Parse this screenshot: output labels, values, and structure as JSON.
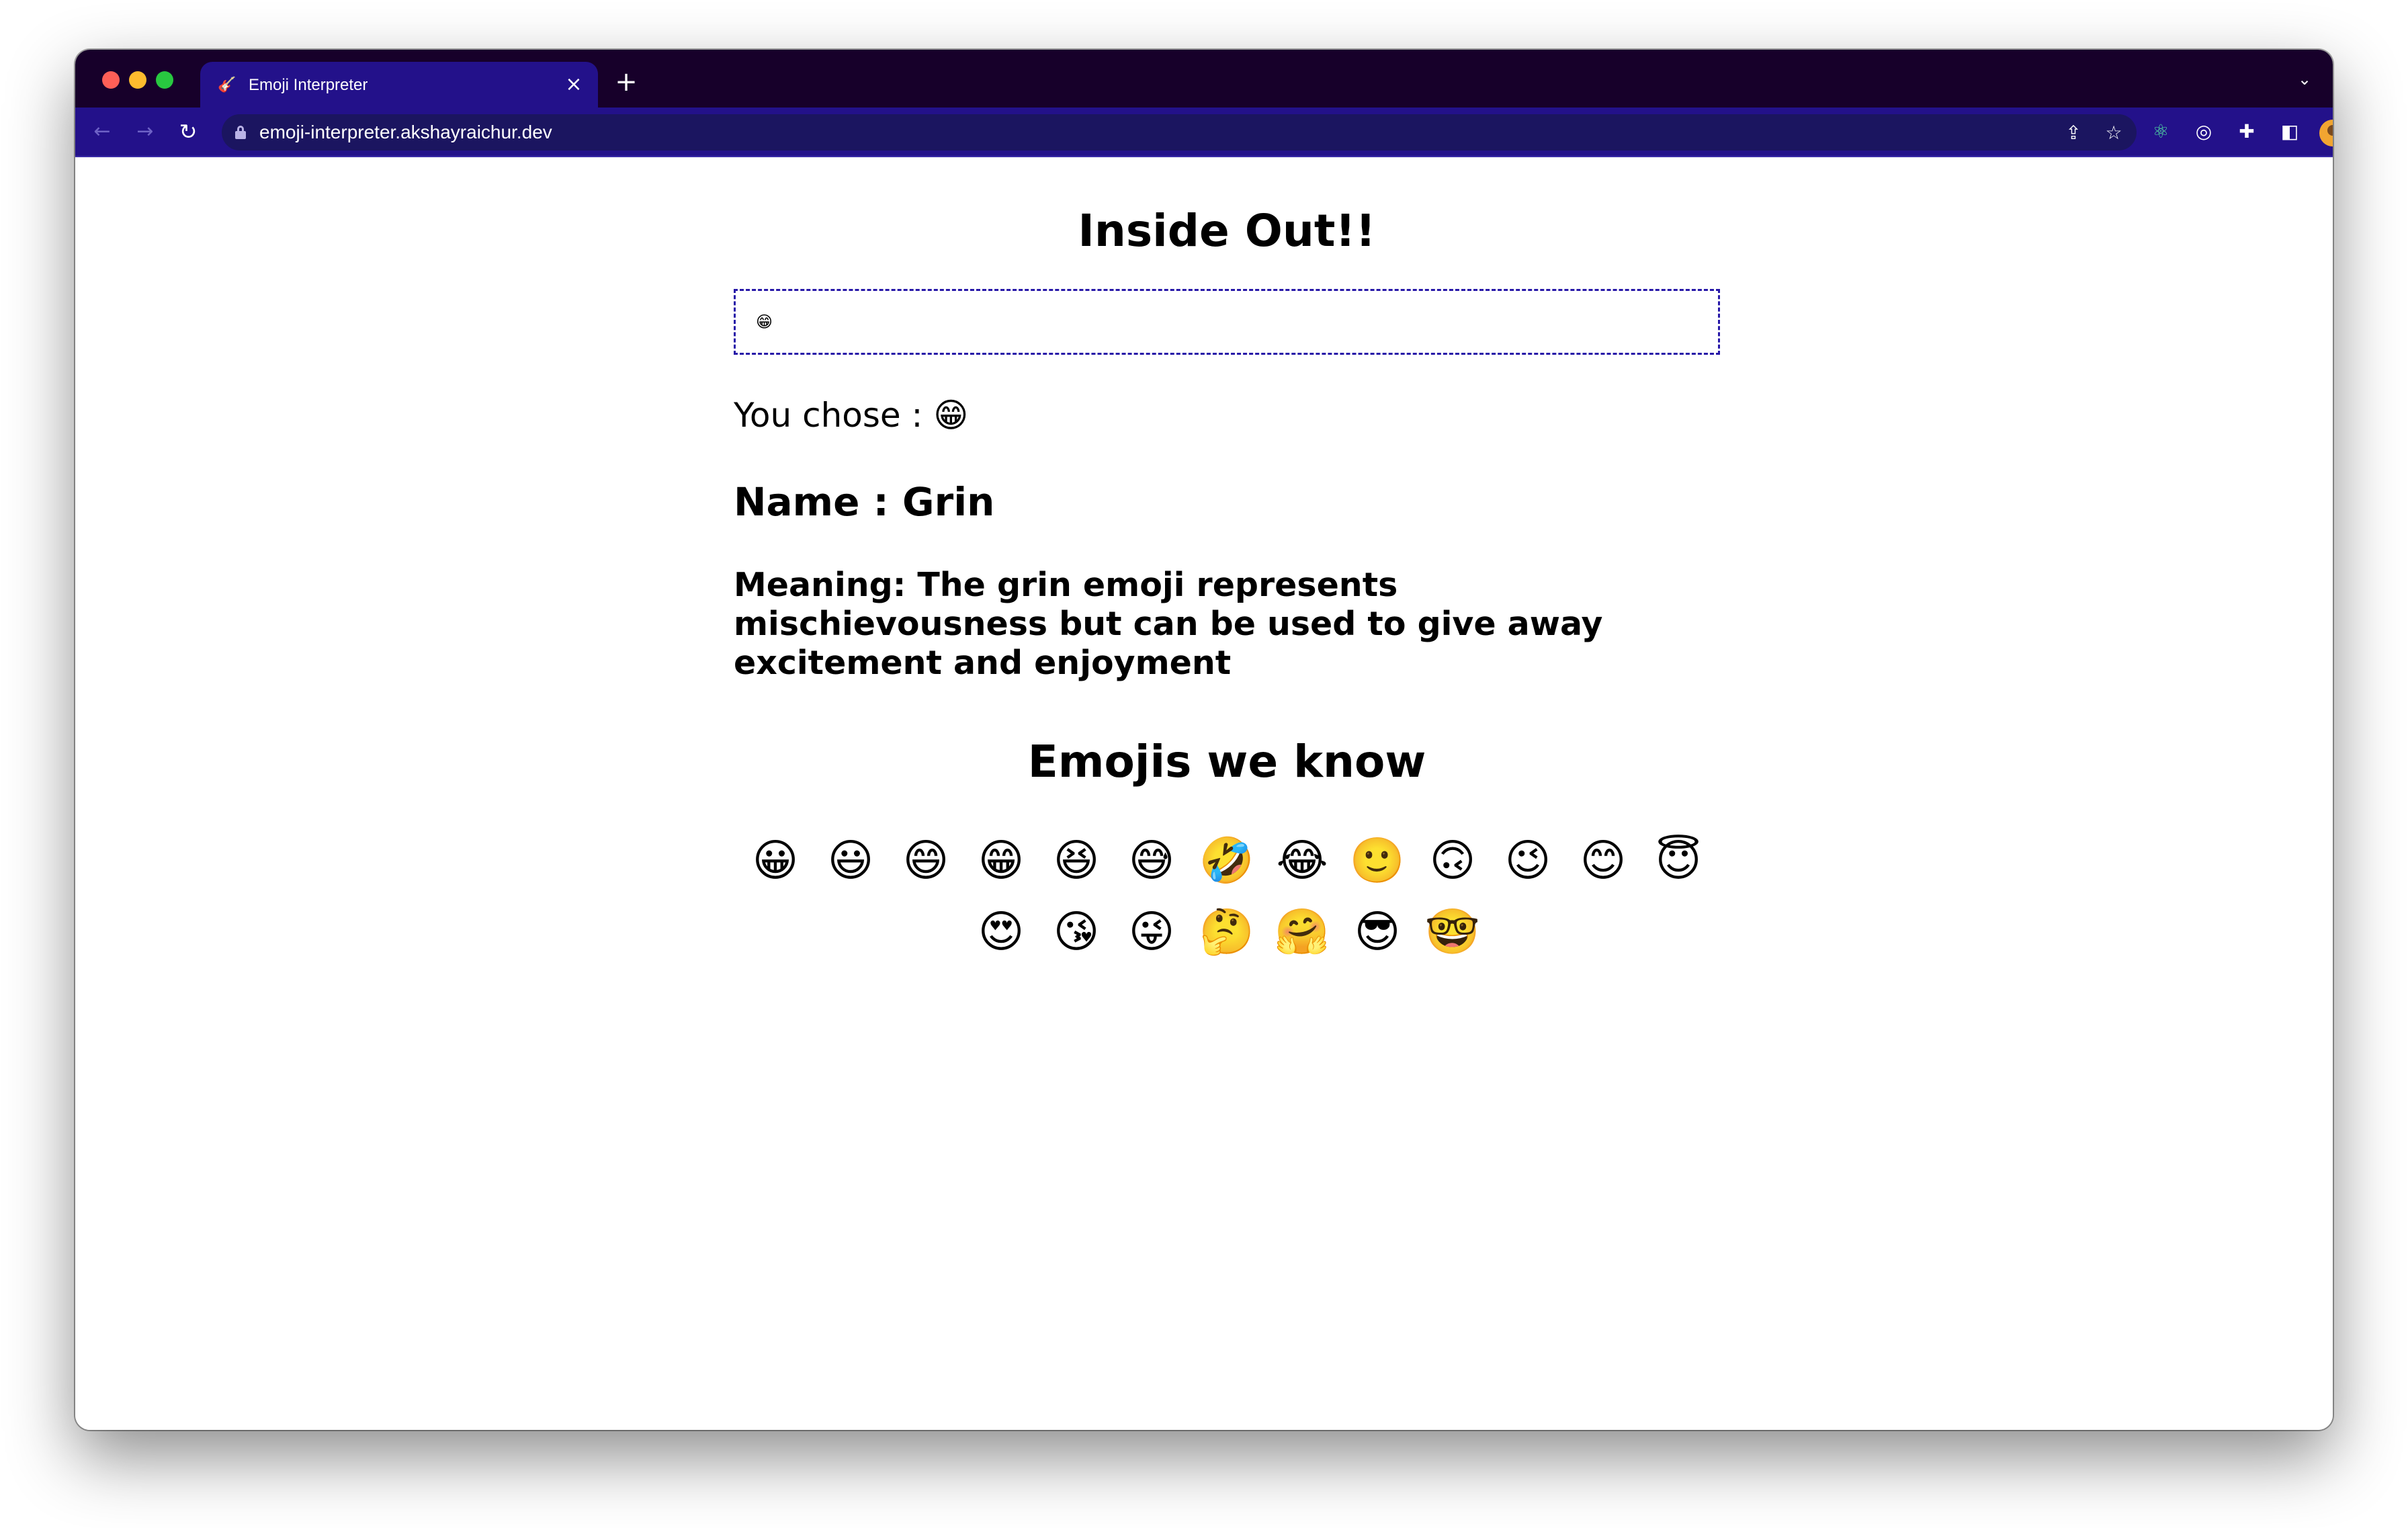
{
  "browser": {
    "tab_title": "Emoji Interpreter",
    "tab_favicon": "🎸",
    "url": "emoji-interpreter.akshayraichur.dev"
  },
  "page": {
    "title": "Inside Out!!",
    "input_value": "😁",
    "chosen_label": "You chose : 😁",
    "name_label": "Name : Grin",
    "meaning_label": "Meaning: The grin emoji represents mischievousness but can be used to give away excitement and enjoyment",
    "known_title": "Emojis we know",
    "emojis": [
      "😀",
      "😃",
      "😄",
      "😁",
      "😆",
      "😅",
      "🤣",
      "😂",
      "🙂",
      "🙃",
      "😉",
      "😊",
      "😇",
      "😍",
      "😘",
      "😜",
      "🤔",
      "🤗",
      "😎",
      "🤓"
    ]
  },
  "colors": {
    "tabbar": "#17002a",
    "toolbar": "#23118a",
    "input_border": "#2718a8"
  }
}
